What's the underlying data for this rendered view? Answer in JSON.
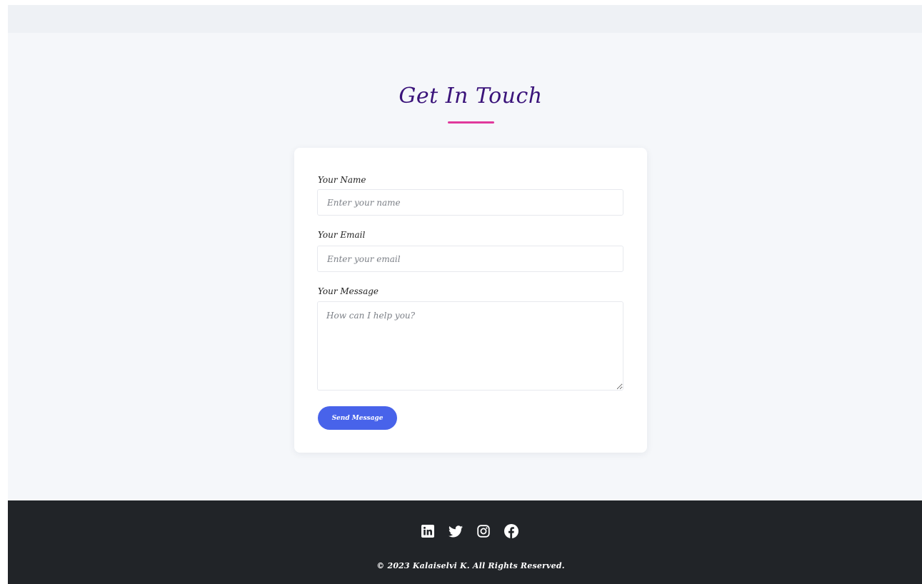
{
  "contact": {
    "title": "Get In Touch",
    "accent_color": "#e0399c",
    "title_color": "#3a137a"
  },
  "form": {
    "name_label": "Your Name",
    "name_placeholder": "Enter your name",
    "email_label": "Your Email",
    "email_placeholder": "Enter your email",
    "message_label": "Your Message",
    "message_placeholder": "How can I help you?",
    "submit_label": "Send Message",
    "button_color": "#4863ea"
  },
  "footer": {
    "social_icons": [
      "linkedin-icon",
      "twitter-icon",
      "instagram-icon",
      "facebook-icon"
    ],
    "copyright": "© 2023 Kalaiselvi K. All Rights Reserved.",
    "background": "#212428"
  }
}
